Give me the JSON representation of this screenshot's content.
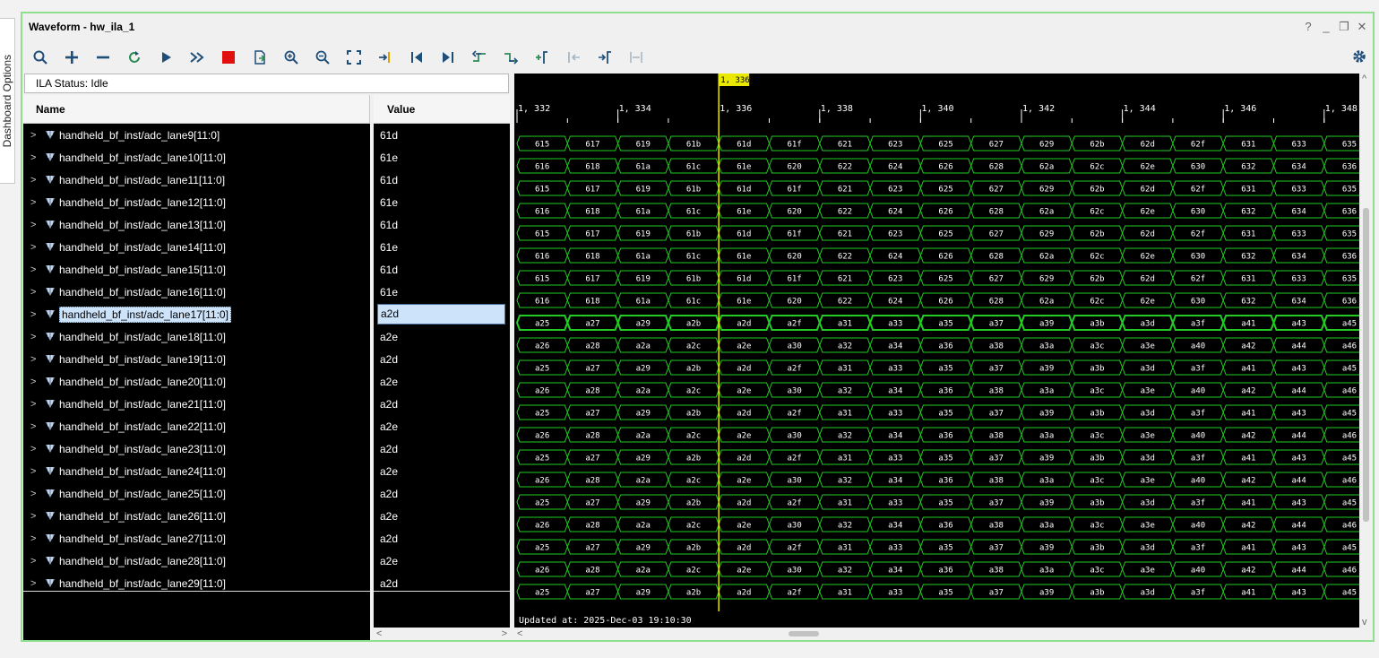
{
  "sidebar": {
    "dashboard_options_label": "Dashboard Options"
  },
  "window": {
    "title": "Waveform - hw_ila_1",
    "help": "?",
    "minimize": "_",
    "restore": "❐",
    "close": "✕"
  },
  "toolbar": {
    "icons": [
      "search-icon",
      "add-icon",
      "remove-icon",
      "refresh-icon",
      "run-trigger-icon",
      "run-immediate-icon",
      "stop-icon",
      "export-icon",
      "zoom-in-icon",
      "zoom-out-icon",
      "zoom-fit-icon",
      "go-to-cursor-icon",
      "go-to-start-icon",
      "go-to-end-icon",
      "previous-transition-icon",
      "next-transition-icon",
      "add-marker-icon",
      "previous-marker-icon",
      "next-marker-icon",
      "swap-cursors-icon"
    ],
    "settings_icon": "gear-icon"
  },
  "ila_status": "ILA Status: Idle",
  "columns": {
    "name": "Name",
    "value": "Value"
  },
  "signals": [
    {
      "name": "handheld_bf_inst/adc_lane9[11:0]",
      "value": "61d",
      "group": "A"
    },
    {
      "name": "handheld_bf_inst/adc_lane10[11:0]",
      "value": "61e",
      "group": "B"
    },
    {
      "name": "handheld_bf_inst/adc_lane11[11:0]",
      "value": "61d",
      "group": "A"
    },
    {
      "name": "handheld_bf_inst/adc_lane12[11:0]",
      "value": "61e",
      "group": "B"
    },
    {
      "name": "handheld_bf_inst/adc_lane13[11:0]",
      "value": "61d",
      "group": "A"
    },
    {
      "name": "handheld_bf_inst/adc_lane14[11:0]",
      "value": "61e",
      "group": "B"
    },
    {
      "name": "handheld_bf_inst/adc_lane15[11:0]",
      "value": "61d",
      "group": "A"
    },
    {
      "name": "handheld_bf_inst/adc_lane16[11:0]",
      "value": "61e",
      "group": "B"
    },
    {
      "name": "handheld_bf_inst/adc_lane17[11:0]",
      "value": "a2d",
      "group": "C",
      "selected": true
    },
    {
      "name": "handheld_bf_inst/adc_lane18[11:0]",
      "value": "a2e",
      "group": "D"
    },
    {
      "name": "handheld_bf_inst/adc_lane19[11:0]",
      "value": "a2d",
      "group": "C"
    },
    {
      "name": "handheld_bf_inst/adc_lane20[11:0]",
      "value": "a2e",
      "group": "D"
    },
    {
      "name": "handheld_bf_inst/adc_lane21[11:0]",
      "value": "a2d",
      "group": "C"
    },
    {
      "name": "handheld_bf_inst/adc_lane22[11:0]",
      "value": "a2e",
      "group": "D"
    },
    {
      "name": "handheld_bf_inst/adc_lane23[11:0]",
      "value": "a2d",
      "group": "C"
    },
    {
      "name": "handheld_bf_inst/adc_lane24[11:0]",
      "value": "a2e",
      "group": "D"
    },
    {
      "name": "handheld_bf_inst/adc_lane25[11:0]",
      "value": "a2d",
      "group": "C"
    },
    {
      "name": "handheld_bf_inst/adc_lane26[11:0]",
      "value": "a2e",
      "group": "D"
    },
    {
      "name": "handheld_bf_inst/adc_lane27[11:0]",
      "value": "a2d",
      "group": "C"
    },
    {
      "name": "handheld_bf_inst/adc_lane28[11:0]",
      "value": "a2e",
      "group": "D"
    },
    {
      "name": "handheld_bf_inst/adc_lane29[11:0]",
      "value": "a2d",
      "group": "C"
    }
  ],
  "timeline": {
    "ticks": [
      "1, 332",
      "1, 334",
      "1, 336",
      "1, 338",
      "1, 340",
      "1, 342",
      "1, 344",
      "1, 346",
      "1, 348"
    ],
    "cursor_label": "1, 336",
    "cursor_sample": 1336
  },
  "wave_values": {
    "A": [
      "615",
      "617",
      "619",
      "61b",
      "61d",
      "61f",
      "621",
      "623",
      "625",
      "627",
      "629",
      "62b",
      "62d",
      "62f",
      "631",
      "633",
      "635"
    ],
    "B": [
      "616",
      "618",
      "61a",
      "61c",
      "61e",
      "620",
      "622",
      "624",
      "626",
      "628",
      "62a",
      "62c",
      "62e",
      "630",
      "632",
      "634",
      "636"
    ],
    "C": [
      "a25",
      "a27",
      "a29",
      "a2b",
      "a2d",
      "a2f",
      "a31",
      "a33",
      "a35",
      "a37",
      "a39",
      "a3b",
      "a3d",
      "a3f",
      "a41",
      "a43",
      "a45"
    ],
    "D": [
      "a26",
      "a28",
      "a2a",
      "a2c",
      "a2e",
      "a30",
      "a32",
      "a34",
      "a36",
      "a38",
      "a3a",
      "a3c",
      "a3e",
      "a40",
      "a42",
      "a44",
      "a46"
    ]
  },
  "colors": {
    "wave": "#22cc22",
    "cursor": "#e8e800",
    "selected_bg": "#cde3fa",
    "panel_border": "#8ee08e"
  },
  "updated_text": "Updated at: 2025-Dec-03 19:10:30"
}
